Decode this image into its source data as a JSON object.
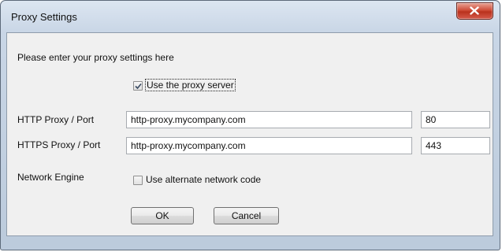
{
  "window": {
    "title": "Proxy Settings"
  },
  "intro_text": "Please enter your proxy settings here",
  "use_proxy": {
    "label": "Use the proxy server",
    "checked": true
  },
  "http": {
    "label": "HTTP Proxy / Port",
    "host": "http-proxy.mycompany.com",
    "port": "80"
  },
  "https": {
    "label": "HTTPS Proxy / Port",
    "host": "http-proxy.mycompany.com",
    "port": "443"
  },
  "network_engine": {
    "label": "Network Engine",
    "option_label": "Use alternate network code",
    "checked": false
  },
  "buttons": {
    "ok": "OK",
    "cancel": "Cancel"
  },
  "icons": {
    "close": "close-icon",
    "check": "checkmark-icon"
  },
  "colors": {
    "close_button": "#c9432f",
    "title_bar": "#c9d6e6",
    "client_background": "#f0f0f0"
  }
}
